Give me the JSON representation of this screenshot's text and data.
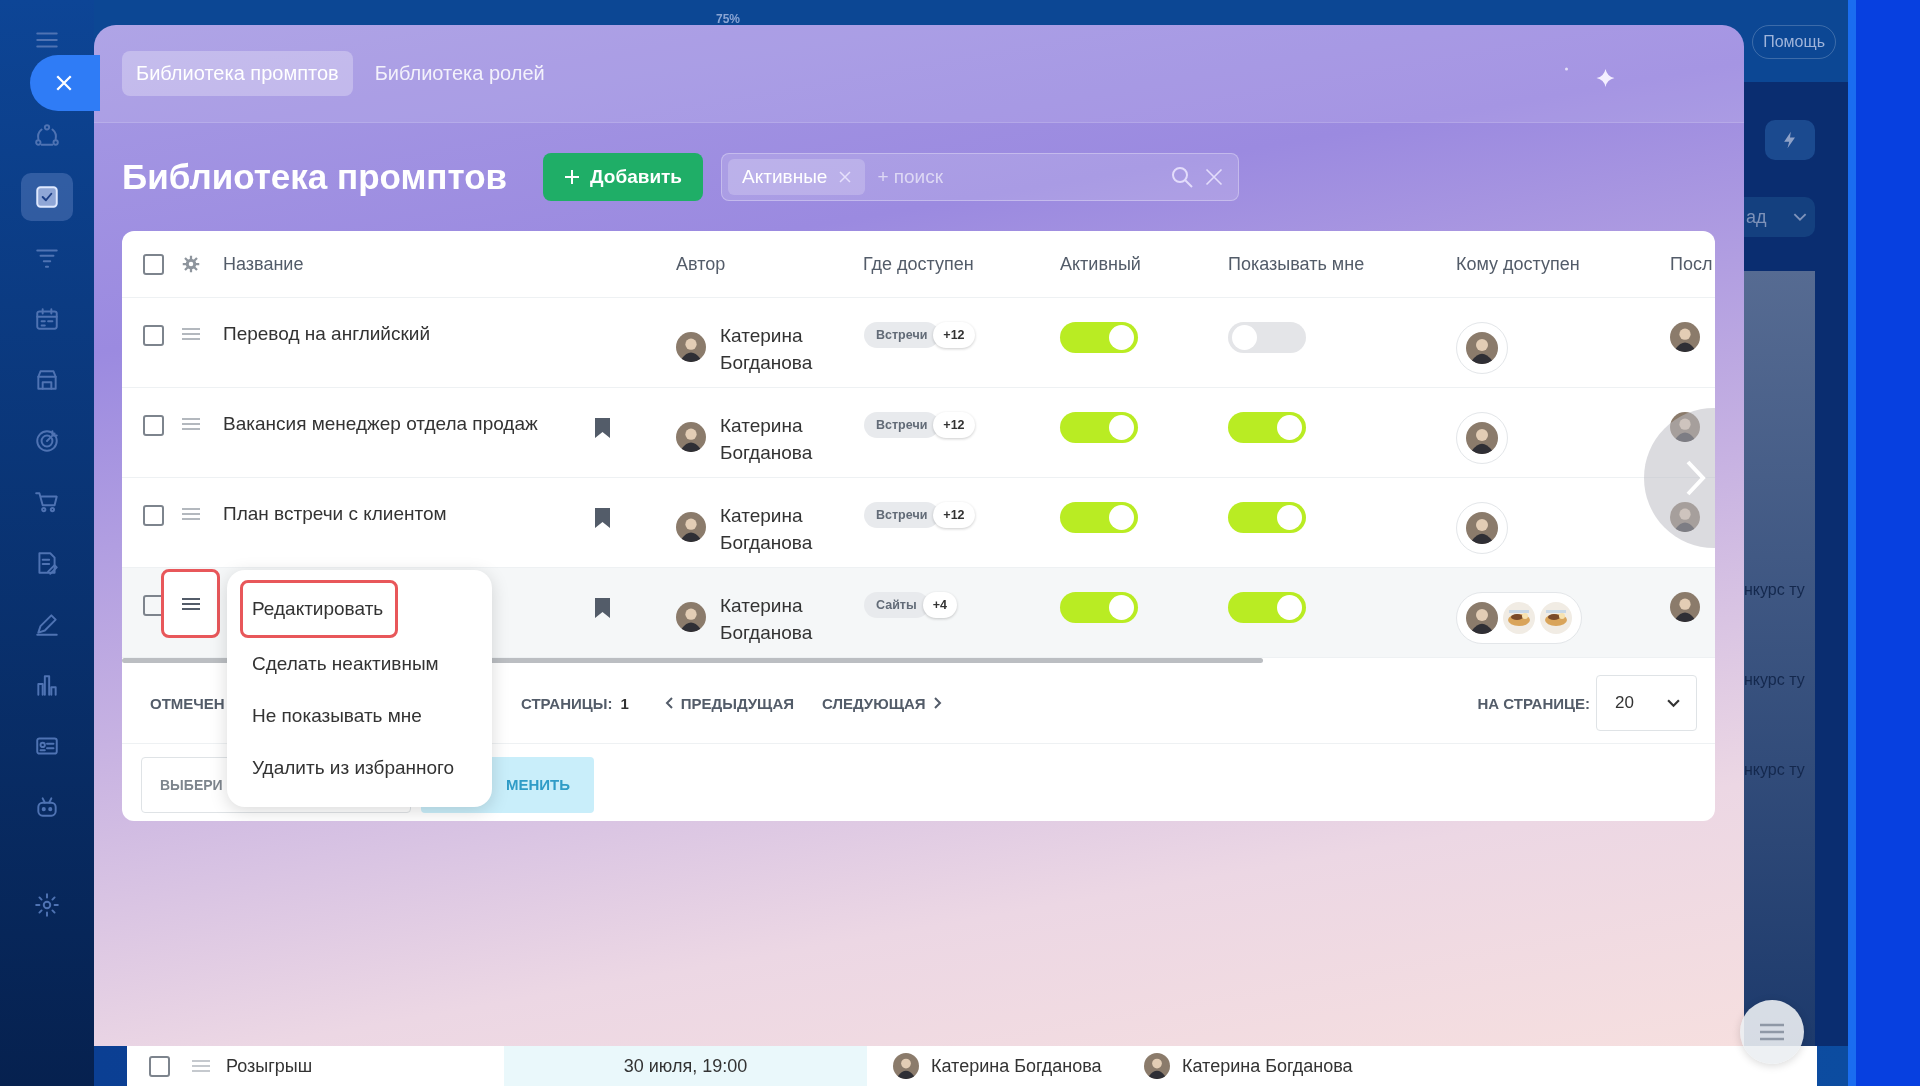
{
  "sidebar": {
    "items": [
      {
        "kind": "menu",
        "selected": false
      },
      {
        "kind": "flow",
        "selected": false
      },
      {
        "kind": "tasks",
        "selected": true
      },
      {
        "kind": "funnel",
        "selected": false
      },
      {
        "kind": "calendar",
        "selected": false
      },
      {
        "kind": "store",
        "selected": false
      },
      {
        "kind": "target",
        "selected": false
      },
      {
        "kind": "cart",
        "selected": false
      },
      {
        "kind": "document",
        "selected": false
      },
      {
        "kind": "pen",
        "selected": false
      },
      {
        "kind": "chart",
        "selected": false
      },
      {
        "kind": "card",
        "selected": false
      },
      {
        "kind": "robot",
        "selected": false
      },
      {
        "kind": "gear",
        "selected": false
      }
    ]
  },
  "background": {
    "zoom": "75%",
    "help": "Помощь",
    "dropdown": "ад",
    "items": [
      "нкурс ту",
      "нкурс ту",
      "нкурс ту"
    ],
    "row": {
      "checked": false,
      "name": "Розыгрыш",
      "date": "30 июля, 19:00",
      "people": [
        "Катерина Богданова",
        "Катерина Богданова"
      ]
    }
  },
  "panel": {
    "tabs": [
      {
        "label": "Библиотека промптов",
        "selected": true
      },
      {
        "label": "Библиотека ролей",
        "selected": false
      }
    ],
    "title": "Библиотека промптов",
    "add_button": "Добавить",
    "filter": {
      "chip": "Активные",
      "placeholder": "+ поиск"
    },
    "table": {
      "select_all": false,
      "columns": [
        "Название",
        "Автор",
        "Где доступен",
        "Активный",
        "Показывать мне",
        "Кому доступен",
        "Посл"
      ],
      "rows": [
        {
          "checked": false,
          "highlighted": false,
          "menu_open": false,
          "name": "Перевод на английский",
          "bookmarked": false,
          "author": "Катерина Богданова",
          "where": {
            "tag": "Встречи",
            "more": "+12"
          },
          "active": true,
          "show_me": false,
          "shared_with": [
            {
              "kind": "person"
            }
          ]
        },
        {
          "checked": false,
          "highlighted": false,
          "menu_open": false,
          "name": "Вакансия менеджер отдела продаж",
          "bookmarked": true,
          "author": "Катерина Богданова",
          "where": {
            "tag": "Встречи",
            "more": "+12"
          },
          "active": true,
          "show_me": true,
          "shared_with": [
            {
              "kind": "person"
            }
          ]
        },
        {
          "checked": false,
          "highlighted": false,
          "menu_open": false,
          "name": "План встречи с клиентом",
          "bookmarked": true,
          "author": "Катерина Богданова",
          "where": {
            "tag": "Встречи",
            "more": "+12"
          },
          "active": true,
          "show_me": true,
          "shared_with": [
            {
              "kind": "person"
            }
          ]
        },
        {
          "checked": false,
          "highlighted": true,
          "menu_open": true,
          "bookmarked": true,
          "author": "Катерина Богданова",
          "where": {
            "tag": "Сайты",
            "more": "+4"
          },
          "active": true,
          "show_me": true,
          "shared_with": [
            {
              "kind": "person"
            },
            {
              "kind": "picture"
            },
            {
              "kind": "picture"
            }
          ]
        }
      ]
    },
    "footer": {
      "selected_label": "ОТМЕЧЕН",
      "pages_label": "СТРАНИЦЫ:",
      "pages": "1",
      "prev": "ПРЕДЫДУЩАЯ",
      "next": "СЛЕДУЮЩАЯ",
      "per_page_label": "НА СТРАНИЦЕ:",
      "per_page": "20",
      "action_select": "ВЫБЕРИ",
      "apply": "МЕНИТЬ"
    },
    "context_menu": {
      "items": [
        {
          "label": "Редактировать",
          "highlighted": true
        },
        {
          "label": "Сделать неактивным",
          "highlighted": false
        },
        {
          "label": "Не показывать мне",
          "highlighted": false
        },
        {
          "label": "Удалить из избранного",
          "highlighted": false
        }
      ]
    }
  }
}
